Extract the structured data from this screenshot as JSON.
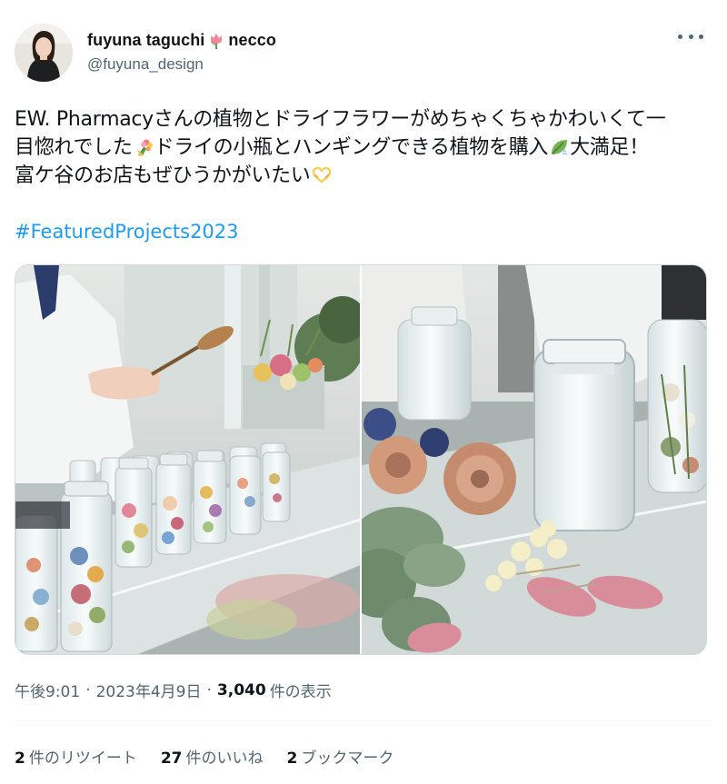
{
  "user": {
    "display_name": "fuyuna taguchi",
    "name_suffix": "necco",
    "name_emoji": "tulip-emoji",
    "handle": "@fuyuna_design",
    "more_icon": "more-horizontal-icon"
  },
  "tweet": {
    "lines": [
      [
        "EW. Pharmacyさんの植物とドライフラワーがめちゃくちゃかわいくて一"
      ],
      [
        "目惚れでした",
        "ドライの小瓶とハンギングできる植物を購入",
        "大満足！"
      ],
      [
        "富ケ谷のお店もぜひうかがいたい"
      ]
    ],
    "emojis": [
      "bouquet-emoji",
      "leaf-wind-emoji",
      "heart-hands-emoji"
    ],
    "hashtag": "#FeaturedProjects2023"
  },
  "media": {
    "photos": [
      "dried-flowers-jars-counter",
      "dried-flowers-glass-jar-closeup"
    ]
  },
  "meta": {
    "time": "午後9:01",
    "date": "2023年4月9日",
    "views_count": "3,040",
    "views_label": "件の表示"
  },
  "stats": {
    "retweets_count": "2",
    "retweets_label": "件のリツイート",
    "likes_count": "27",
    "likes_label": "件のいいね",
    "bookmarks_count": "2",
    "bookmarks_label": "ブックマーク"
  },
  "colors": {
    "text": "#0f1419",
    "secondary": "#536471",
    "link": "#1d9bf0",
    "border": "#cfd9de"
  }
}
